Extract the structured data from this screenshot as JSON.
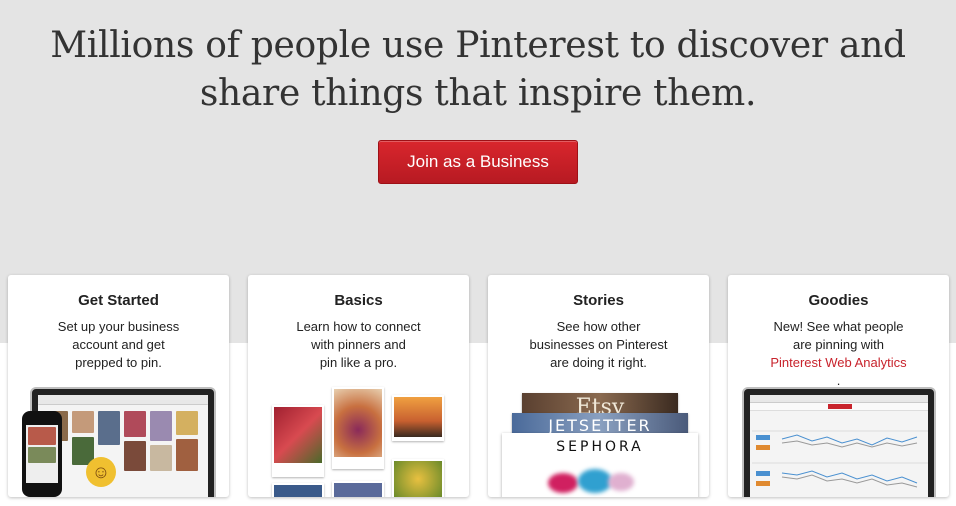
{
  "hero": {
    "title_line1": "Millions of people use Pinterest to discover and",
    "title_line2": "share things that inspire them.",
    "join_button": "Join as a Business"
  },
  "cards": [
    {
      "title": "Get Started",
      "desc_line1": "Set up your business",
      "desc_line2": "account and get",
      "desc_line3": "prepped to pin."
    },
    {
      "title": "Basics",
      "desc_line1": "Learn how to connect",
      "desc_line2": "with pinners and",
      "desc_line3": "pin like a pro."
    },
    {
      "title": "Stories",
      "desc_line1": "See how other",
      "desc_line2": "businesses on Pinterest",
      "desc_line3": "are doing it right.",
      "brands": [
        "Etsy",
        "JETSETTER",
        "SEPHORA"
      ]
    },
    {
      "title": "Goodies",
      "desc_line1": "New! See what people",
      "desc_line2": "are pinning with",
      "desc_link": "Pinterest Web Analytics",
      "desc_suffix": "."
    }
  ],
  "colors": {
    "brand_red": "#c8232c",
    "background": "#e4e4e4"
  }
}
